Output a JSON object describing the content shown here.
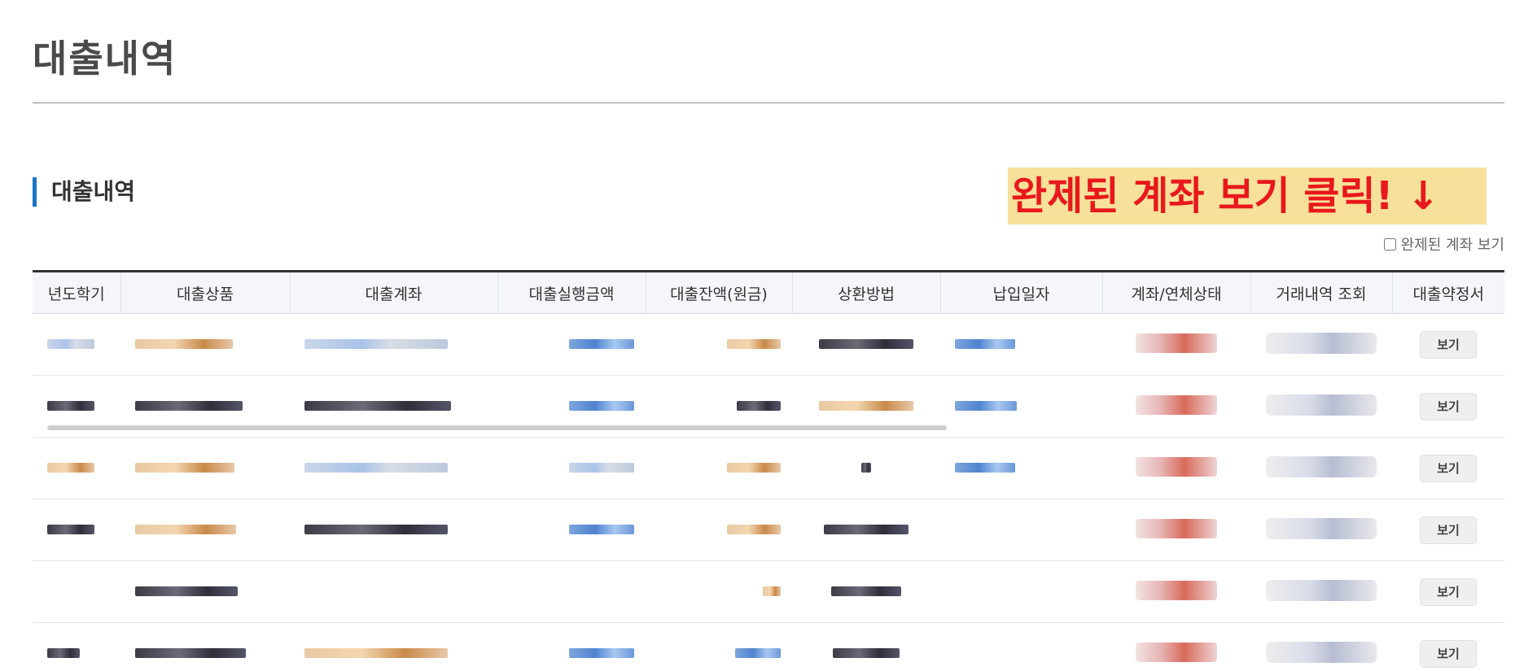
{
  "page": {
    "title": "대출내역"
  },
  "section": {
    "title": "대출내역"
  },
  "annotation": {
    "text": "완제된 계좌 보기 클릭! ↓",
    "background": "#f7e09a",
    "color": "#e8181c"
  },
  "filter": {
    "show_closed_label": "완제된 계좌 보기",
    "checked": false
  },
  "table": {
    "headers": [
      "년도학기",
      "대출상품",
      "대출계좌",
      "대출실행금액",
      "대출잔액(원금)",
      "상환방법",
      "납입일자",
      "계좌/연체상태",
      "거래내역 조회",
      "대출약정서"
    ],
    "rows": [
      {
        "view_label": "보기"
      },
      {
        "view_label": "보기"
      },
      {
        "view_label": "보기"
      },
      {
        "view_label": "보기"
      },
      {
        "view_label": "보기"
      },
      {
        "view_label": "보기"
      }
    ]
  },
  "colors": {
    "accent": "#1a74c8",
    "header_bg": "#f5f6fa"
  }
}
